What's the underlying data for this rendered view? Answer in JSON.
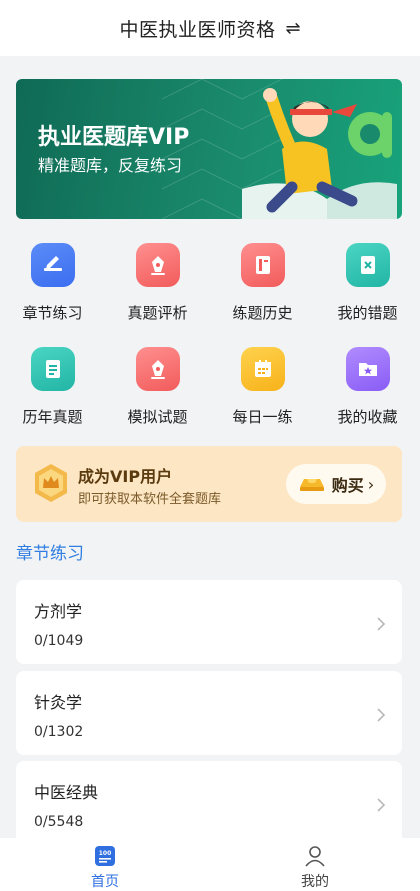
{
  "header": {
    "title": "中医执业医师资格",
    "switch_icon": "swap-arrows-icon",
    "switch_glyph": "⇌"
  },
  "banner": {
    "title": "执业医题库VIP",
    "subtitle": "精准题库，反复练习",
    "colors": {
      "bg": "#1a8a6c"
    }
  },
  "grid": {
    "items": [
      {
        "label": "章节练习",
        "icon": "pencil-doc-icon",
        "color": "blue"
      },
      {
        "label": "真题评析",
        "icon": "pen-nib-icon",
        "color": "red"
      },
      {
        "label": "练题历史",
        "icon": "notebook-icon",
        "color": "red"
      },
      {
        "label": "我的错题",
        "icon": "error-note-icon",
        "color": "teal"
      },
      {
        "label": "历年真题",
        "icon": "document-icon",
        "color": "teal"
      },
      {
        "label": "模拟试题",
        "icon": "pen-nib-icon",
        "color": "red"
      },
      {
        "label": "每日一练",
        "icon": "calendar-icon",
        "color": "yellow"
      },
      {
        "label": "我的收藏",
        "icon": "star-folder-icon",
        "color": "purple"
      }
    ]
  },
  "vip": {
    "title": "成为VIP用户",
    "subtitle": "即可获取本软件全套题库",
    "buy_label": "购买",
    "chevron": "›"
  },
  "section": {
    "title": "章节练习"
  },
  "chapters": [
    {
      "name": "方剂学",
      "progress": "0/1049"
    },
    {
      "name": "针灸学",
      "progress": "0/1302"
    },
    {
      "name": "中医经典",
      "progress": "0/5548"
    }
  ],
  "tabbar": {
    "home_label": "首页",
    "me_label": "我的",
    "accent": "#2f6fe0"
  }
}
